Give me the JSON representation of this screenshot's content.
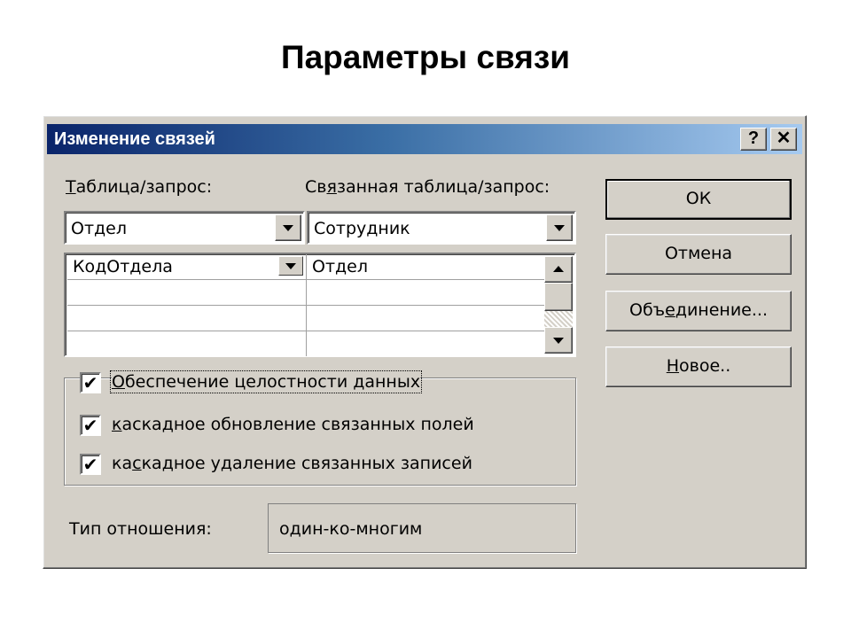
{
  "slide": {
    "title": "Параметры связи"
  },
  "dialog": {
    "title": "Изменение связей",
    "help_label": "?",
    "close_label": "✕",
    "table_label_pre": "",
    "table_label_u": "Т",
    "table_label_post": "аблица/запрос:",
    "related_label_pre": "Св",
    "related_label_u": "я",
    "related_label_post": "занная таблица/запрос:",
    "table_value": "Отдел",
    "related_value": "Сотрудник",
    "fields": {
      "rows": [
        {
          "left": "КодОтдела",
          "right": "Отдел"
        },
        {
          "left": "",
          "right": ""
        },
        {
          "left": "",
          "right": ""
        },
        {
          "left": "",
          "right": ""
        }
      ]
    },
    "integrity": {
      "label_pre": "",
      "label_u": "О",
      "label_post": "беспечение целостности данных",
      "checked": "✔"
    },
    "cascade_update": {
      "label_pre": "",
      "label_u": "к",
      "label_post": "аскадное обновление связанных полей",
      "checked": "✔"
    },
    "cascade_delete": {
      "label_pre": "ка",
      "label_u": "с",
      "label_post": "кадное удаление связанных записей",
      "checked": "✔"
    },
    "relation_type_label": "Тип отношения:",
    "relation_type_value": "один-ко-многим",
    "buttons": {
      "ok": "ОК",
      "cancel": "Отмена",
      "join_pre": "Объ",
      "join_u": "е",
      "join_post": "динение...",
      "new_pre": "",
      "new_u": "Н",
      "new_post": "овое.."
    }
  }
}
